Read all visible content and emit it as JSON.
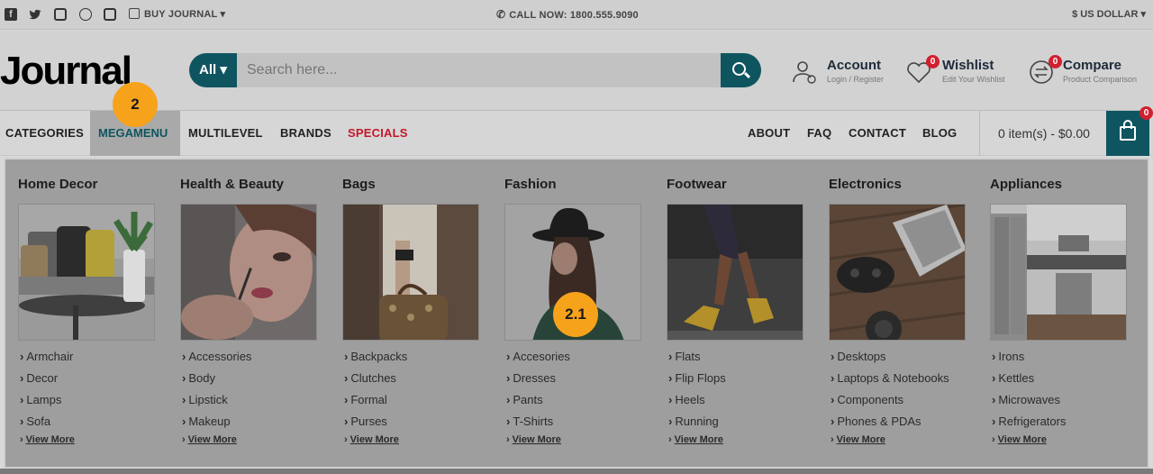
{
  "topbar": {
    "social_icons": [
      "facebook-icon",
      "twitter-icon",
      "instagram-icon",
      "whatsapp-icon",
      "pinterest-icon"
    ],
    "buy_label": "BUY JOURNAL ▾",
    "call_label": "CALL NOW: 1800.555.9090",
    "currency_label": "$ US DOLLAR ▾"
  },
  "header": {
    "logo": "Journal",
    "search": {
      "category": "All ▾",
      "placeholder": "Search here..."
    },
    "account": {
      "title": "Account",
      "subtitle": "Login / Register"
    },
    "wishlist": {
      "title": "Wishlist",
      "subtitle": "Edit Your Wishlist",
      "count": "0"
    },
    "compare": {
      "title": "Compare",
      "subtitle": "Product Comparison",
      "count": "0"
    }
  },
  "nav": {
    "left": [
      "CATEGORIES",
      "MEGAMENU",
      "MULTILEVEL",
      "BRANDS",
      "SPECIALS"
    ],
    "right": [
      "ABOUT",
      "FAQ",
      "CONTACT",
      "BLOG"
    ],
    "cart_text": "0 item(s) - $0.00",
    "cart_count": "0"
  },
  "markers": {
    "megamenu": "2",
    "image": "2.1"
  },
  "megamenu": {
    "columns": [
      {
        "title": "Home Decor",
        "links": [
          "Armchair",
          "Decor",
          "Lamps",
          "Sofa"
        ],
        "more": "View More"
      },
      {
        "title": "Health & Beauty",
        "links": [
          "Accessories",
          "Body",
          "Lipstick",
          "Makeup"
        ],
        "more": "View More"
      },
      {
        "title": "Bags",
        "links": [
          "Backpacks",
          "Clutches",
          "Formal",
          "Purses"
        ],
        "more": "View More"
      },
      {
        "title": "Fashion",
        "links": [
          "Accesories",
          "Dresses",
          "Pants",
          "T-Shirts"
        ],
        "more": "View More"
      },
      {
        "title": "Footwear",
        "links": [
          "Flats",
          "Flip Flops",
          "Heels",
          "Running"
        ],
        "more": "View More"
      },
      {
        "title": "Electronics",
        "links": [
          "Desktops",
          "Laptops & Notebooks",
          "Components",
          "Phones & PDAs"
        ],
        "more": "View More"
      },
      {
        "title": "Appliances",
        "links": [
          "Irons",
          "Kettles",
          "Microwaves",
          "Refrigerators"
        ],
        "more": "View More"
      }
    ]
  },
  "colors": {
    "accent": "#0f5560",
    "specials": "#c4162a",
    "badge": "#d0202f",
    "marker": "#f7a21b"
  }
}
